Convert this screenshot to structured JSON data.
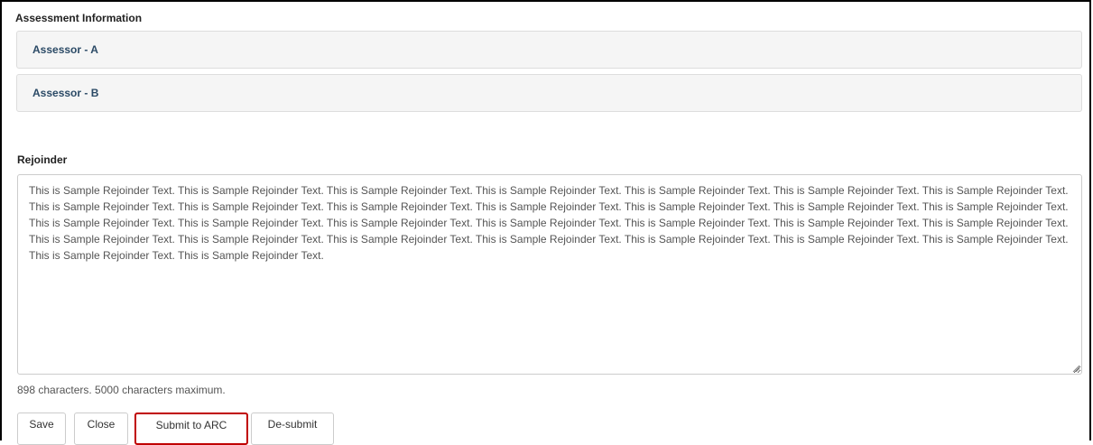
{
  "assessment": {
    "heading": "Assessment Information",
    "panels": [
      {
        "title": "Assessor - A"
      },
      {
        "title": "Assessor - B"
      }
    ]
  },
  "rejoinder": {
    "label": "Rejoinder",
    "text": "This is Sample Rejoinder Text. This is Sample Rejoinder Text. This is Sample Rejoinder Text. This is Sample Rejoinder Text. This is Sample Rejoinder Text. This is Sample Rejoinder Text. This is Sample Rejoinder Text. This is Sample Rejoinder Text. This is Sample Rejoinder Text. This is Sample Rejoinder Text. This is Sample Rejoinder Text. This is Sample Rejoinder Text. This is Sample Rejoinder Text. This is Sample Rejoinder Text. This is Sample Rejoinder Text. This is Sample Rejoinder Text. This is Sample Rejoinder Text. This is Sample Rejoinder Text. This is Sample Rejoinder Text. This is Sample Rejoinder Text. This is Sample Rejoinder Text. This is Sample Rejoinder Text. This is Sample Rejoinder Text. This is Sample Rejoinder Text. This is Sample Rejoinder Text. This is Sample Rejoinder Text. This is Sample Rejoinder Text. This is Sample Rejoinder Text. This is Sample Rejoinder Text. This is Sample Rejoinder Text.",
    "char_count": "898 characters. 5000 characters maximum."
  },
  "buttons": {
    "save": "Save",
    "close": "Close",
    "submit": "Submit to ARC",
    "desubmit": "De-submit"
  },
  "colors": {
    "panel_title": "#2b4a66",
    "panel_bg": "#f5f5f5",
    "highlight_border": "#c00000"
  }
}
